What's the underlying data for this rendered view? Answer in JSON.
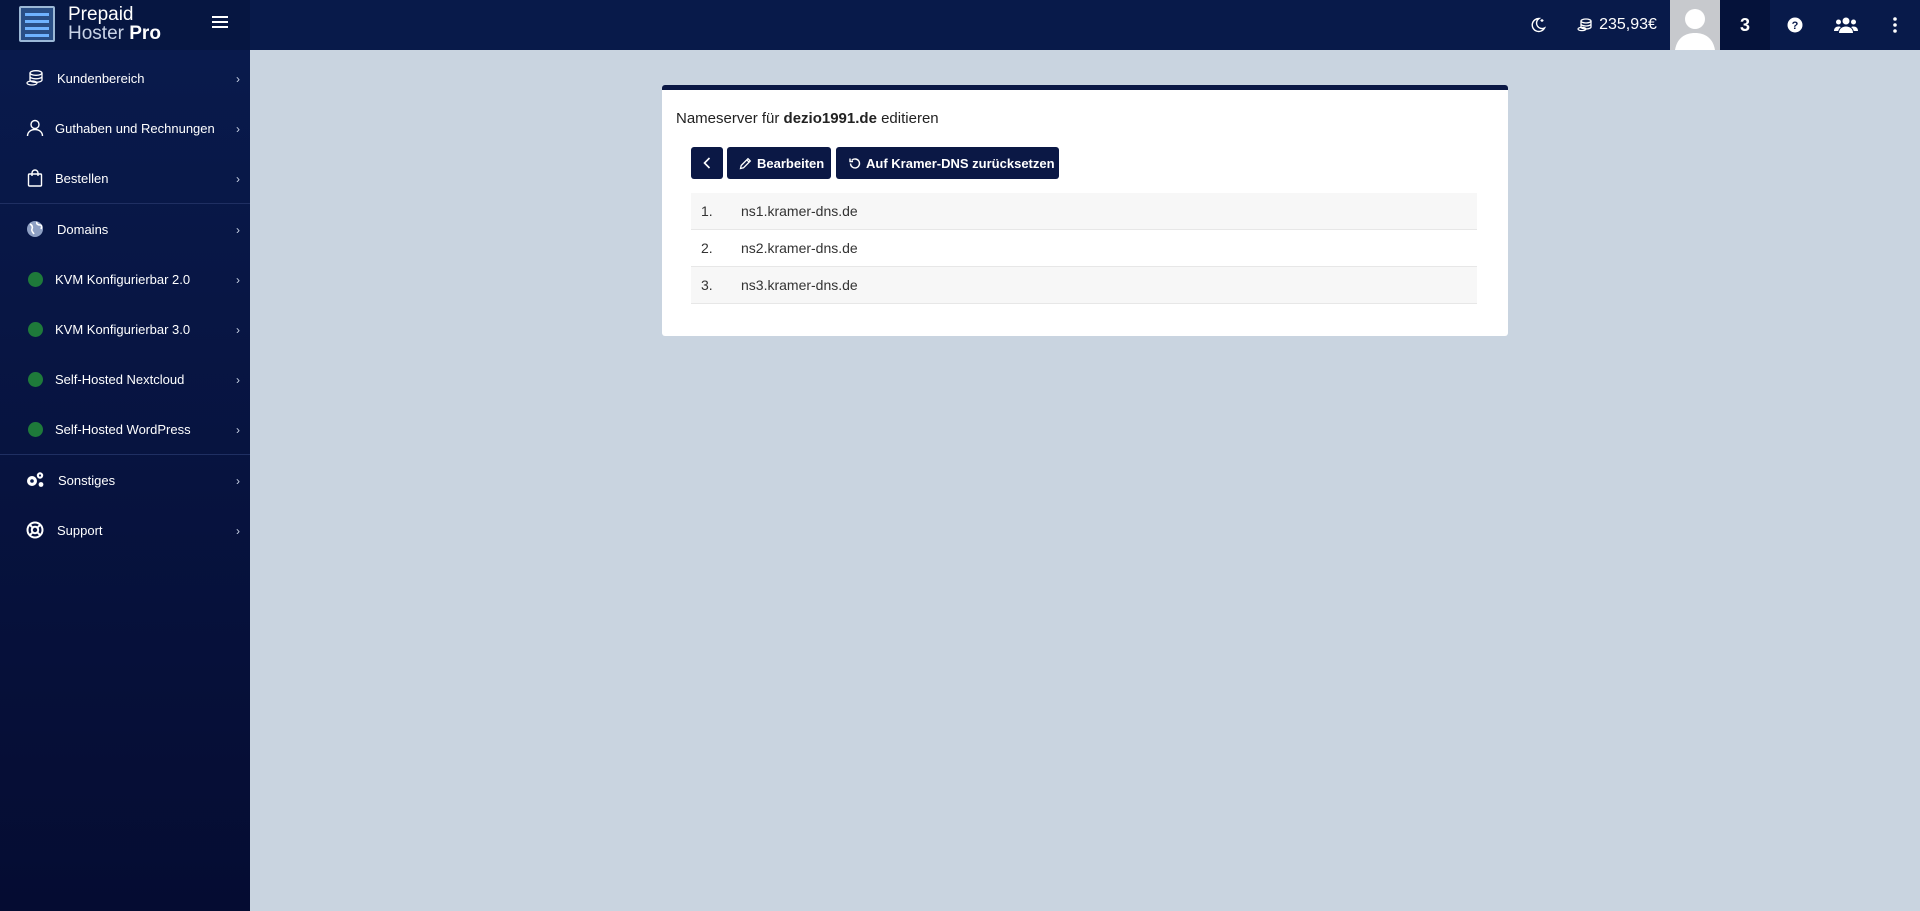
{
  "brand": {
    "line1": "Prepaid",
    "line2a": "Hoster",
    "line2b": "Pro"
  },
  "topbar": {
    "credit": "235,93€",
    "count": "3",
    "icons": [
      "moon-icon",
      "coins-icon",
      "avatar",
      "help-icon",
      "users-icon",
      "more-icon"
    ]
  },
  "sidebar": {
    "items": [
      {
        "label": "Kundenbereich",
        "icon": "coins-icon"
      },
      {
        "label": "Guthaben und Rechnungen",
        "icon": "user-icon"
      },
      {
        "label": "Bestellen",
        "icon": "shopping-bag-icon"
      },
      {
        "label": "Domains",
        "icon": "globe-icon"
      },
      {
        "label": "KVM Konfigurierbar 2.0",
        "icon": "status-dot"
      },
      {
        "label": "KVM Konfigurierbar 3.0",
        "icon": "status-dot"
      },
      {
        "label": "Self-Hosted Nextcloud",
        "icon": "status-dot"
      },
      {
        "label": "Self-Hosted WordPress",
        "icon": "status-dot"
      },
      {
        "label": "Sonstiges",
        "icon": "gears-icon"
      },
      {
        "label": "Support",
        "icon": "lifebuoy-icon"
      }
    ]
  },
  "card": {
    "title_prefix": "Nameserver für",
    "domain": "dezio1991.de",
    "title_suffix": "editieren",
    "buttons": {
      "edit": "Bearbeiten",
      "reset": "Auf Kramer-DNS zurücksetzen"
    },
    "nameservers": [
      {
        "num": "1.",
        "value": "ns1.kramer-dns.de"
      },
      {
        "num": "2.",
        "value": "ns2.kramer-dns.de"
      },
      {
        "num": "3.",
        "value": "ns3.kramer-dns.de"
      }
    ]
  },
  "colors": {
    "navy": "#0b1845",
    "status_green": "#1e7a3a",
    "background": "#c9d4e0"
  }
}
